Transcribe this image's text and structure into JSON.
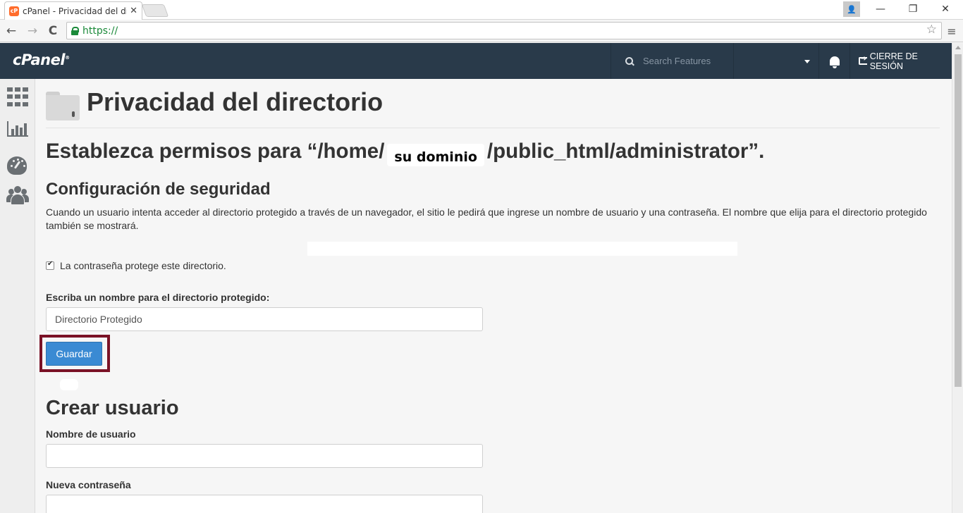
{
  "browser": {
    "tab_title": "cPanel - Privacidad del dir",
    "tab_favicon": "cP",
    "tab_close": "✕",
    "url": "https://",
    "star": "☆",
    "menu": "≡",
    "back": "←",
    "forward": "→",
    "reload": "C",
    "minimize": "—",
    "restore": "❐",
    "close": "✕",
    "profile": "👤"
  },
  "header": {
    "logo": "cPanel",
    "logo_mark": "®",
    "search_placeholder": "Search Features",
    "logout_label": "CIERRE DE SESIÓN",
    "background": "#293a4a"
  },
  "sidebar": {
    "icons": [
      "grid-icon",
      "stats-icon",
      "gauge-icon",
      "users-icon"
    ]
  },
  "main": {
    "page_title": "Privacidad del directorio",
    "perm_prefix": "Establezca permisos para “",
    "perm_path_start": "/home/",
    "perm_domain": "su dominio",
    "perm_path_end": "/public_html/administrator",
    "perm_suffix": "”.",
    "security_title": "Configuración de seguridad",
    "security_desc": "Cuando un usuario intenta acceder al directorio protegido a través de un navegador, el sitio le pedirá que ingrese un nombre de usuario y una contraseña. El nombre que elija para el directorio protegido también se mostrará.",
    "protect_checkbox_label": "La contraseña protege este directorio.",
    "protect_checked": true,
    "dir_name_label": "Escriba un nombre para el directorio protegido:",
    "dir_name_value": "Directorio Protegido",
    "save_label": "Guardar",
    "create_user_title": "Crear usuario",
    "username_label": "Nombre de usuario",
    "username_value": "",
    "new_password_label": "Nueva contraseña",
    "new_password_value": "",
    "accent_color": "#3a8ad3",
    "highlight_color": "#7a1226"
  }
}
